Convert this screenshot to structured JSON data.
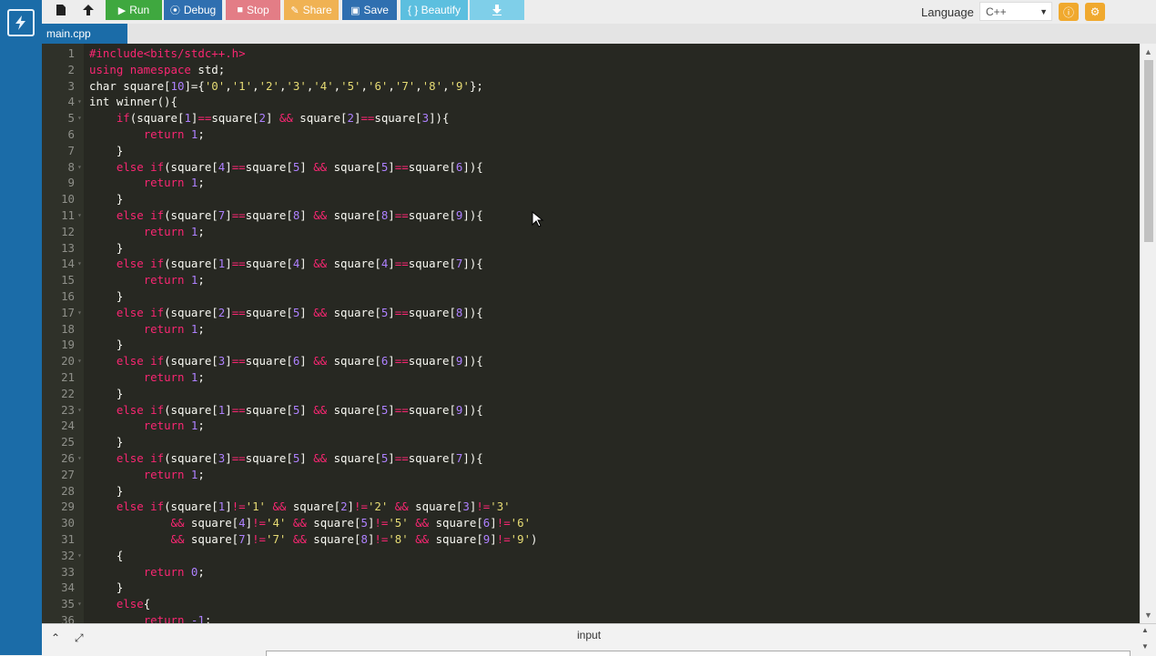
{
  "toolbar": {
    "run_label": "Run",
    "debug_label": "Debug",
    "stop_label": "Stop",
    "share_label": "Share",
    "save_label": "Save",
    "beautify_label": "{ } Beautify",
    "language_label": "Language",
    "language_value": "C++"
  },
  "tabs": [
    {
      "label": "main.cpp"
    }
  ],
  "bottom": {
    "input_label": "input"
  },
  "colors": {
    "rail": "#1b6ca8",
    "run": "#3fa83f",
    "debug": "#2f6fb0",
    "stop": "#e37d86",
    "share": "#f0b253",
    "save": "#2f6fb0",
    "beautify": "#5cbfdf",
    "editor_bg": "#272822"
  },
  "code": [
    {
      "n": "1",
      "fold": false,
      "html": "<span class='pp'>#include&lt;bits/stdc++.h&gt;</span>"
    },
    {
      "n": "2",
      "fold": false,
      "html": "<span class='kw'>using namespace</span> std;"
    },
    {
      "n": "3",
      "fold": false,
      "html": "char square[<span class='num'>10</span>]={<span class='str'>'0'</span>,<span class='str'>'1'</span>,<span class='str'>'2'</span>,<span class='str'>'3'</span>,<span class='str'>'4'</span>,<span class='str'>'5'</span>,<span class='str'>'6'</span>,<span class='str'>'7'</span>,<span class='str'>'8'</span>,<span class='str'>'9'</span>};"
    },
    {
      "n": "4",
      "fold": true,
      "html": "int winner(){"
    },
    {
      "n": "5",
      "fold": true,
      "html": "    <span class='kw'>if</span>(square[<span class='num'>1</span>]<span class='op'>==</span>square[<span class='num'>2</span>] <span class='op'>&amp;&amp;</span> square[<span class='num'>2</span>]<span class='op'>==</span>square[<span class='num'>3</span>]){"
    },
    {
      "n": "6",
      "fold": false,
      "html": "        <span class='kw'>return</span> <span class='num'>1</span>;"
    },
    {
      "n": "7",
      "fold": false,
      "html": "    }"
    },
    {
      "n": "8",
      "fold": true,
      "html": "    <span class='kw'>else if</span>(square[<span class='num'>4</span>]<span class='op'>==</span>square[<span class='num'>5</span>] <span class='op'>&amp;&amp;</span> square[<span class='num'>5</span>]<span class='op'>==</span>square[<span class='num'>6</span>]){"
    },
    {
      "n": "9",
      "fold": false,
      "html": "        <span class='kw'>return</span> <span class='num'>1</span>;"
    },
    {
      "n": "10",
      "fold": false,
      "html": "    }"
    },
    {
      "n": "11",
      "fold": true,
      "html": "    <span class='kw'>else if</span>(square[<span class='num'>7</span>]<span class='op'>==</span>square[<span class='num'>8</span>] <span class='op'>&amp;&amp;</span> square[<span class='num'>8</span>]<span class='op'>==</span>square[<span class='num'>9</span>]){"
    },
    {
      "n": "12",
      "fold": false,
      "html": "        <span class='kw'>return</span> <span class='num'>1</span>;"
    },
    {
      "n": "13",
      "fold": false,
      "html": "    }"
    },
    {
      "n": "14",
      "fold": true,
      "html": "    <span class='kw'>else if</span>(square[<span class='num'>1</span>]<span class='op'>==</span>square[<span class='num'>4</span>] <span class='op'>&amp;&amp;</span> square[<span class='num'>4</span>]<span class='op'>==</span>square[<span class='num'>7</span>]){"
    },
    {
      "n": "15",
      "fold": false,
      "html": "        <span class='kw'>return</span> <span class='num'>1</span>;"
    },
    {
      "n": "16",
      "fold": false,
      "html": "    }"
    },
    {
      "n": "17",
      "fold": true,
      "html": "    <span class='kw'>else if</span>(square[<span class='num'>2</span>]<span class='op'>==</span>square[<span class='num'>5</span>] <span class='op'>&amp;&amp;</span> square[<span class='num'>5</span>]<span class='op'>==</span>square[<span class='num'>8</span>]){"
    },
    {
      "n": "18",
      "fold": false,
      "html": "        <span class='kw'>return</span> <span class='num'>1</span>;"
    },
    {
      "n": "19",
      "fold": false,
      "html": "    }"
    },
    {
      "n": "20",
      "fold": true,
      "html": "    <span class='kw'>else if</span>(square[<span class='num'>3</span>]<span class='op'>==</span>square[<span class='num'>6</span>] <span class='op'>&amp;&amp;</span> square[<span class='num'>6</span>]<span class='op'>==</span>square[<span class='num'>9</span>]){"
    },
    {
      "n": "21",
      "fold": false,
      "html": "        <span class='kw'>return</span> <span class='num'>1</span>;"
    },
    {
      "n": "22",
      "fold": false,
      "html": "    }"
    },
    {
      "n": "23",
      "fold": true,
      "html": "    <span class='kw'>else if</span>(square[<span class='num'>1</span>]<span class='op'>==</span>square[<span class='num'>5</span>] <span class='op'>&amp;&amp;</span> square[<span class='num'>5</span>]<span class='op'>==</span>square[<span class='num'>9</span>]){"
    },
    {
      "n": "24",
      "fold": false,
      "html": "        <span class='kw'>return</span> <span class='num'>1</span>;"
    },
    {
      "n": "25",
      "fold": false,
      "html": "    }"
    },
    {
      "n": "26",
      "fold": true,
      "html": "    <span class='kw'>else if</span>(square[<span class='num'>3</span>]<span class='op'>==</span>square[<span class='num'>5</span>] <span class='op'>&amp;&amp;</span> square[<span class='num'>5</span>]<span class='op'>==</span>square[<span class='num'>7</span>]){"
    },
    {
      "n": "27",
      "fold": false,
      "html": "        <span class='kw'>return</span> <span class='num'>1</span>;"
    },
    {
      "n": "28",
      "fold": false,
      "html": "    }"
    },
    {
      "n": "29",
      "fold": false,
      "html": "    <span class='kw'>else if</span>(square[<span class='num'>1</span>]<span class='op'>!=</span><span class='str'>'1'</span> <span class='op'>&amp;&amp;</span> square[<span class='num'>2</span>]<span class='op'>!=</span><span class='str'>'2'</span> <span class='op'>&amp;&amp;</span> square[<span class='num'>3</span>]<span class='op'>!=</span><span class='str'>'3'</span>"
    },
    {
      "n": "30",
      "fold": false,
      "html": "            <span class='op'>&amp;&amp;</span> square[<span class='num'>4</span>]<span class='op'>!=</span><span class='str'>'4'</span> <span class='op'>&amp;&amp;</span> square[<span class='num'>5</span>]<span class='op'>!=</span><span class='str'>'5'</span> <span class='op'>&amp;&amp;</span> square[<span class='num'>6</span>]<span class='op'>!=</span><span class='str'>'6'</span>"
    },
    {
      "n": "31",
      "fold": false,
      "html": "            <span class='op'>&amp;&amp;</span> square[<span class='num'>7</span>]<span class='op'>!=</span><span class='str'>'7'</span> <span class='op'>&amp;&amp;</span> square[<span class='num'>8</span>]<span class='op'>!=</span><span class='str'>'8'</span> <span class='op'>&amp;&amp;</span> square[<span class='num'>9</span>]<span class='op'>!=</span><span class='str'>'9'</span>)"
    },
    {
      "n": "32",
      "fold": true,
      "html": "    {"
    },
    {
      "n": "33",
      "fold": false,
      "html": "        <span class='kw'>return</span> <span class='num'>0</span>;"
    },
    {
      "n": "34",
      "fold": false,
      "html": "    }"
    },
    {
      "n": "35",
      "fold": true,
      "html": "    <span class='kw'>else</span>{"
    },
    {
      "n": "36",
      "fold": false,
      "html": "        <span class='kw'>return</span> <span class='num'>-1</span>;"
    }
  ]
}
